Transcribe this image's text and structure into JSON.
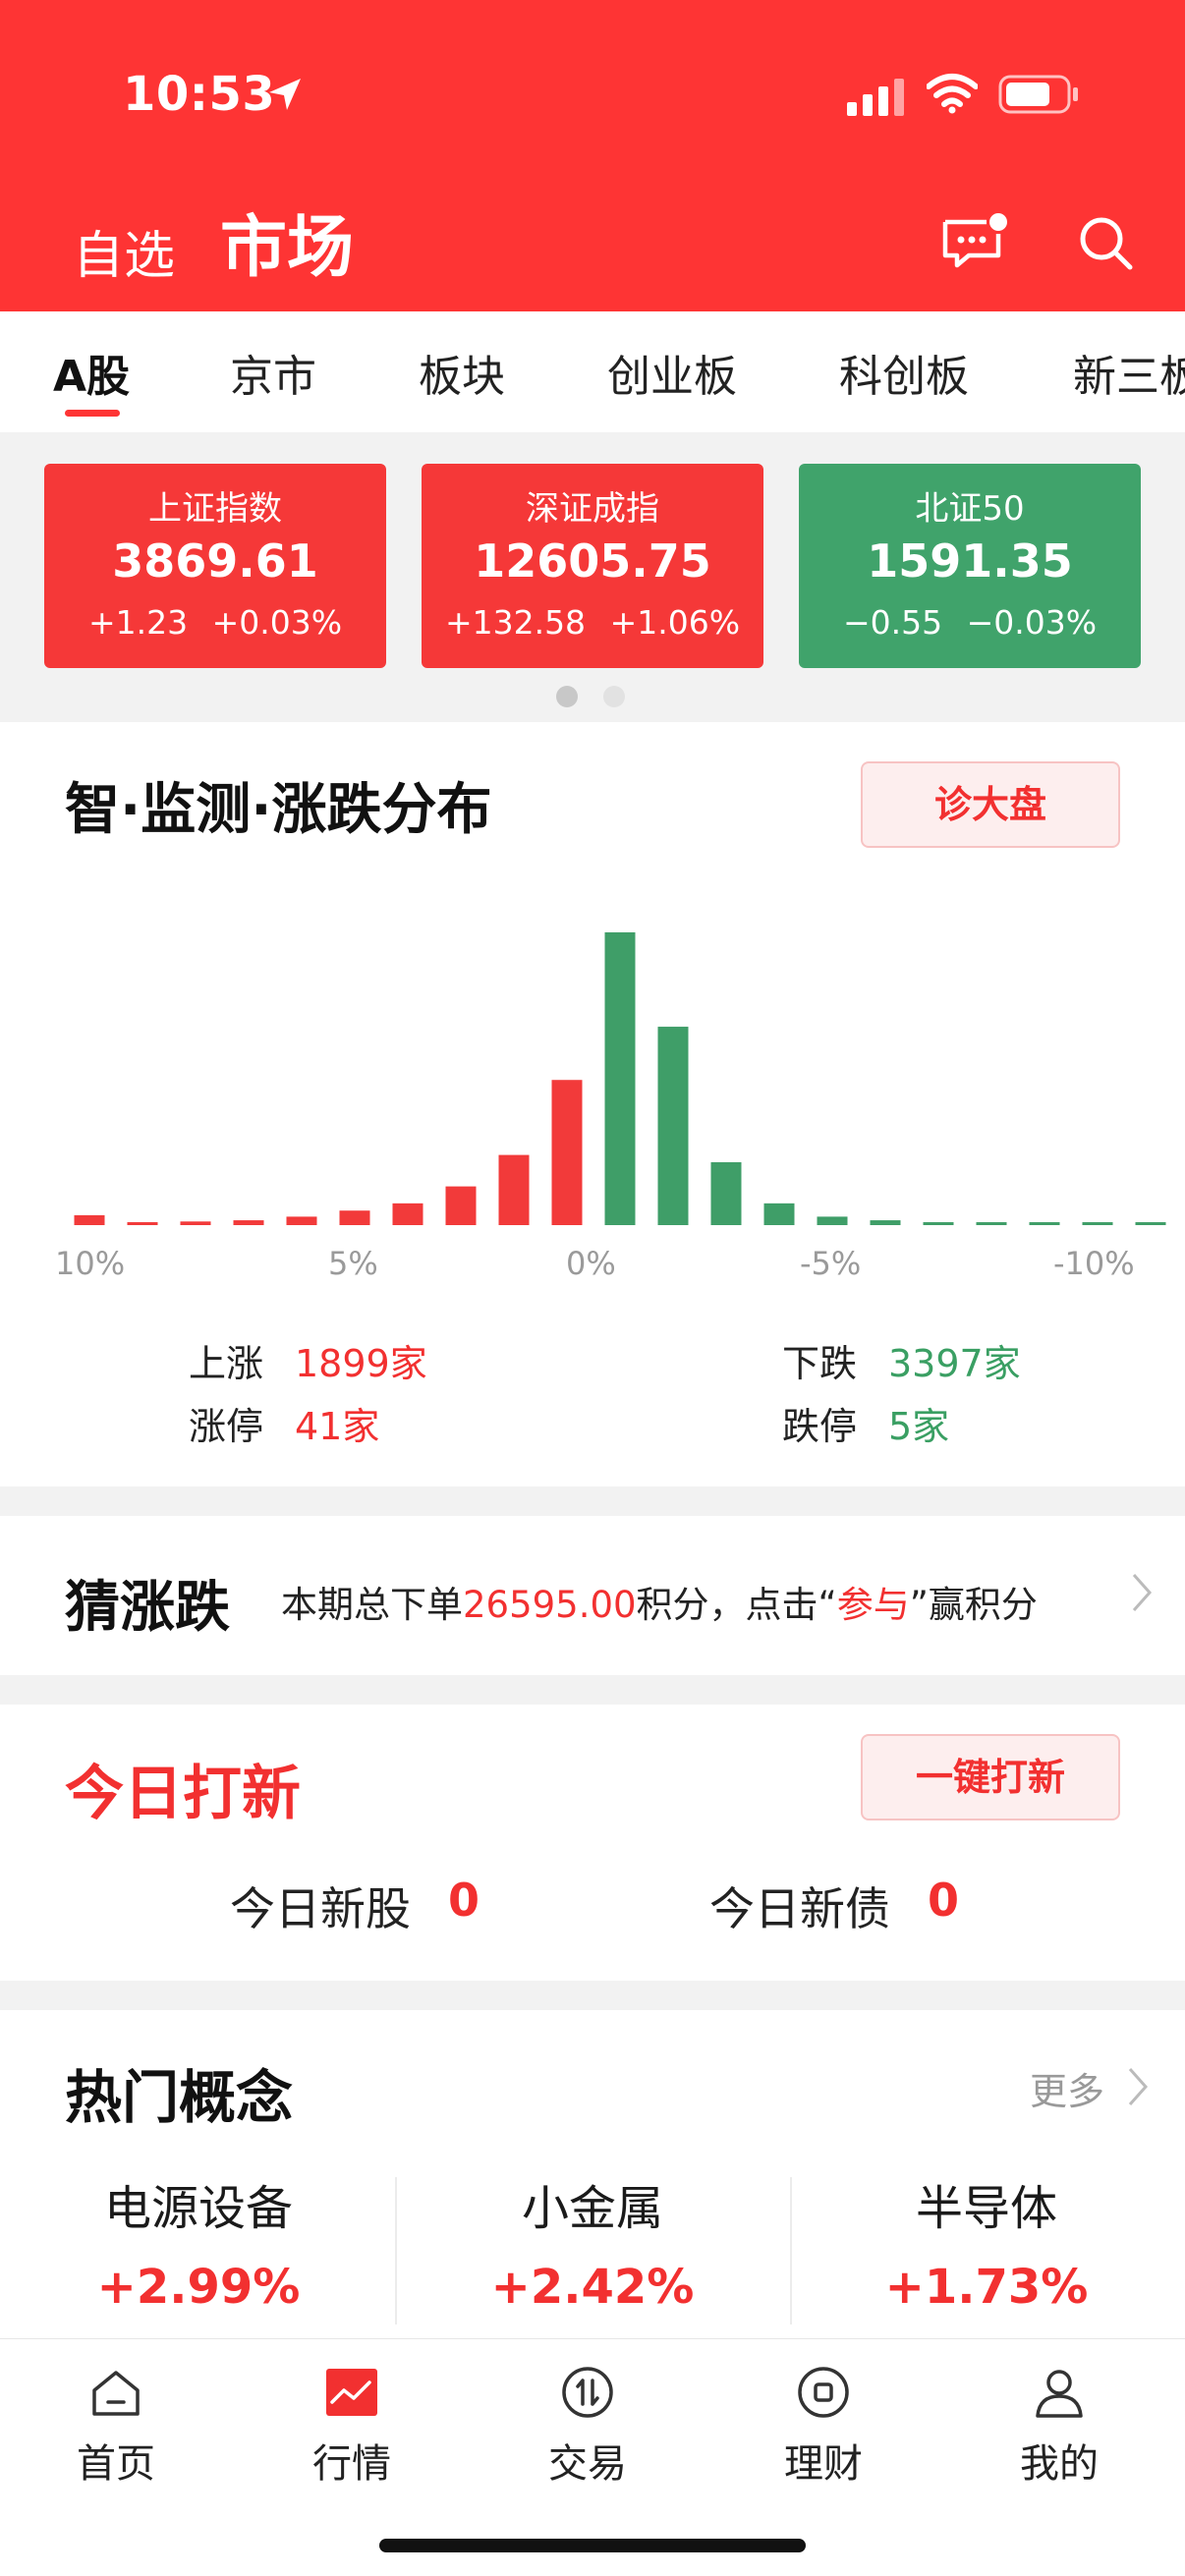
{
  "status_bar": {
    "time": "10:53"
  },
  "header": {
    "nav_left": "自选",
    "nav_active": "市场"
  },
  "tabs": [
    {
      "label": "A股",
      "active": true
    },
    {
      "label": "京市"
    },
    {
      "label": "板块"
    },
    {
      "label": "创业板"
    },
    {
      "label": "科创板"
    },
    {
      "label": "新三板"
    }
  ],
  "indices": [
    {
      "name": "上证指数",
      "value": "3869.61",
      "change": "+1.23",
      "pct": "+0.03%",
      "color": "#f53838"
    },
    {
      "name": "深证成指",
      "value": "12605.75",
      "change": "+132.58",
      "pct": "+1.06%",
      "color": "#f53838"
    },
    {
      "name": "北证50",
      "value": "1591.35",
      "change": "−0.55",
      "pct": "−0.03%",
      "color": "#40a36b"
    }
  ],
  "distribution": {
    "title": "智·监测·涨跌分布",
    "button": "诊大盘",
    "axis_labels": [
      "10%",
      "5%",
      "0%",
      "-5%",
      "-10%"
    ],
    "up_label": "上涨",
    "up_value": "1899家",
    "limit_up_label": "涨停",
    "limit_up_value": "41家",
    "down_label": "下跌",
    "down_value": "3397家",
    "limit_down_label": "跌停",
    "limit_down_value": "5家"
  },
  "chart_data": {
    "type": "bar",
    "categories": [
      "10%",
      "",
      "",
      "",
      "",
      "5%",
      "",
      "",
      "",
      "",
      "0%",
      "",
      "",
      "",
      "",
      "-5%",
      "",
      "",
      "",
      "",
      "-10%"
    ],
    "values": [
      41,
      10,
      15,
      20,
      35,
      60,
      90,
      160,
      290,
      600,
      1210,
      820,
      260,
      90,
      35,
      20,
      8,
      5,
      4,
      4,
      5
    ],
    "colors": [
      "#f23a3a",
      "#f23a3a",
      "#f23a3a",
      "#f23a3a",
      "#f23a3a",
      "#f23a3a",
      "#f23a3a",
      "#f23a3a",
      "#f23a3a",
      "#f23a3a",
      "#3f9e68",
      "#3f9e68",
      "#3f9e68",
      "#3f9e68",
      "#3f9e68",
      "#3f9e68",
      "#3f9e68",
      "#3f9e68",
      "#3f9e68",
      "#3f9e68",
      "#3f9e68"
    ],
    "ylim": [
      0,
      1210
    ],
    "xlabel": "",
    "ylabel": "",
    "grid": false
  },
  "guess": {
    "title": "猜涨跌",
    "desc_prefix": "本期总下单",
    "desc_amount": "26595.00",
    "desc_middle": "积分，点击“",
    "desc_link": "参与",
    "desc_suffix": "”赢积分"
  },
  "ipo": {
    "title": "今日打新",
    "button": "一键打新",
    "stock_label": "今日新股",
    "stock_count": "0",
    "bond_label": "今日新债",
    "bond_count": "0"
  },
  "hot_concepts": {
    "title": "热门概念",
    "more": "更多",
    "items": [
      {
        "name": "电源设备",
        "pct": "+2.99%"
      },
      {
        "name": "小金属",
        "pct": "+2.42%"
      },
      {
        "name": "半导体",
        "pct": "+1.73%"
      }
    ]
  },
  "bottom_nav": [
    {
      "label": "首页",
      "icon": "home-icon"
    },
    {
      "label": "行情",
      "icon": "market-chart-icon",
      "active": true
    },
    {
      "label": "交易",
      "icon": "trade-icon"
    },
    {
      "label": "理财",
      "icon": "wealth-icon"
    },
    {
      "label": "我的",
      "icon": "profile-icon"
    }
  ]
}
